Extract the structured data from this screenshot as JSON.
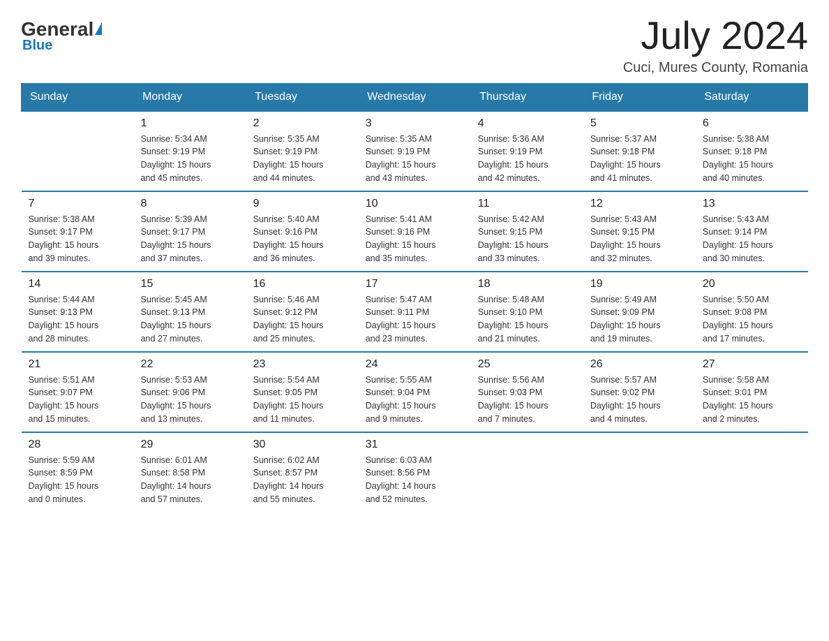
{
  "header": {
    "logo": {
      "general": "General",
      "triangle": "",
      "blue": "Blue"
    },
    "month_title": "July 2024",
    "location": "Cuci, Mures County, Romania"
  },
  "calendar": {
    "days_of_week": [
      "Sunday",
      "Monday",
      "Tuesday",
      "Wednesday",
      "Thursday",
      "Friday",
      "Saturday"
    ],
    "weeks": [
      [
        {
          "day": "",
          "info": ""
        },
        {
          "day": "1",
          "info": "Sunrise: 5:34 AM\nSunset: 9:19 PM\nDaylight: 15 hours\nand 45 minutes."
        },
        {
          "day": "2",
          "info": "Sunrise: 5:35 AM\nSunset: 9:19 PM\nDaylight: 15 hours\nand 44 minutes."
        },
        {
          "day": "3",
          "info": "Sunrise: 5:35 AM\nSunset: 9:19 PM\nDaylight: 15 hours\nand 43 minutes."
        },
        {
          "day": "4",
          "info": "Sunrise: 5:36 AM\nSunset: 9:19 PM\nDaylight: 15 hours\nand 42 minutes."
        },
        {
          "day": "5",
          "info": "Sunrise: 5:37 AM\nSunset: 9:18 PM\nDaylight: 15 hours\nand 41 minutes."
        },
        {
          "day": "6",
          "info": "Sunrise: 5:38 AM\nSunset: 9:18 PM\nDaylight: 15 hours\nand 40 minutes."
        }
      ],
      [
        {
          "day": "7",
          "info": "Sunrise: 5:38 AM\nSunset: 9:17 PM\nDaylight: 15 hours\nand 39 minutes."
        },
        {
          "day": "8",
          "info": "Sunrise: 5:39 AM\nSunset: 9:17 PM\nDaylight: 15 hours\nand 37 minutes."
        },
        {
          "day": "9",
          "info": "Sunrise: 5:40 AM\nSunset: 9:16 PM\nDaylight: 15 hours\nand 36 minutes."
        },
        {
          "day": "10",
          "info": "Sunrise: 5:41 AM\nSunset: 9:16 PM\nDaylight: 15 hours\nand 35 minutes."
        },
        {
          "day": "11",
          "info": "Sunrise: 5:42 AM\nSunset: 9:15 PM\nDaylight: 15 hours\nand 33 minutes."
        },
        {
          "day": "12",
          "info": "Sunrise: 5:43 AM\nSunset: 9:15 PM\nDaylight: 15 hours\nand 32 minutes."
        },
        {
          "day": "13",
          "info": "Sunrise: 5:43 AM\nSunset: 9:14 PM\nDaylight: 15 hours\nand 30 minutes."
        }
      ],
      [
        {
          "day": "14",
          "info": "Sunrise: 5:44 AM\nSunset: 9:13 PM\nDaylight: 15 hours\nand 28 minutes."
        },
        {
          "day": "15",
          "info": "Sunrise: 5:45 AM\nSunset: 9:13 PM\nDaylight: 15 hours\nand 27 minutes."
        },
        {
          "day": "16",
          "info": "Sunrise: 5:46 AM\nSunset: 9:12 PM\nDaylight: 15 hours\nand 25 minutes."
        },
        {
          "day": "17",
          "info": "Sunrise: 5:47 AM\nSunset: 9:11 PM\nDaylight: 15 hours\nand 23 minutes."
        },
        {
          "day": "18",
          "info": "Sunrise: 5:48 AM\nSunset: 9:10 PM\nDaylight: 15 hours\nand 21 minutes."
        },
        {
          "day": "19",
          "info": "Sunrise: 5:49 AM\nSunset: 9:09 PM\nDaylight: 15 hours\nand 19 minutes."
        },
        {
          "day": "20",
          "info": "Sunrise: 5:50 AM\nSunset: 9:08 PM\nDaylight: 15 hours\nand 17 minutes."
        }
      ],
      [
        {
          "day": "21",
          "info": "Sunrise: 5:51 AM\nSunset: 9:07 PM\nDaylight: 15 hours\nand 15 minutes."
        },
        {
          "day": "22",
          "info": "Sunrise: 5:53 AM\nSunset: 9:06 PM\nDaylight: 15 hours\nand 13 minutes."
        },
        {
          "day": "23",
          "info": "Sunrise: 5:54 AM\nSunset: 9:05 PM\nDaylight: 15 hours\nand 11 minutes."
        },
        {
          "day": "24",
          "info": "Sunrise: 5:55 AM\nSunset: 9:04 PM\nDaylight: 15 hours\nand 9 minutes."
        },
        {
          "day": "25",
          "info": "Sunrise: 5:56 AM\nSunset: 9:03 PM\nDaylight: 15 hours\nand 7 minutes."
        },
        {
          "day": "26",
          "info": "Sunrise: 5:57 AM\nSunset: 9:02 PM\nDaylight: 15 hours\nand 4 minutes."
        },
        {
          "day": "27",
          "info": "Sunrise: 5:58 AM\nSunset: 9:01 PM\nDaylight: 15 hours\nand 2 minutes."
        }
      ],
      [
        {
          "day": "28",
          "info": "Sunrise: 5:59 AM\nSunset: 8:59 PM\nDaylight: 15 hours\nand 0 minutes."
        },
        {
          "day": "29",
          "info": "Sunrise: 6:01 AM\nSunset: 8:58 PM\nDaylight: 14 hours\nand 57 minutes."
        },
        {
          "day": "30",
          "info": "Sunrise: 6:02 AM\nSunset: 8:57 PM\nDaylight: 14 hours\nand 55 minutes."
        },
        {
          "day": "31",
          "info": "Sunrise: 6:03 AM\nSunset: 8:56 PM\nDaylight: 14 hours\nand 52 minutes."
        },
        {
          "day": "",
          "info": ""
        },
        {
          "day": "",
          "info": ""
        },
        {
          "day": "",
          "info": ""
        }
      ]
    ]
  }
}
